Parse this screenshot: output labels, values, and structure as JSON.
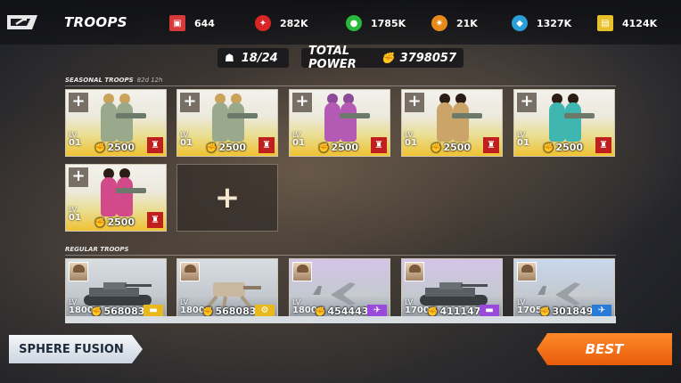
{
  "header": {
    "title": "TROOPS",
    "resources": [
      {
        "icon": "red-crate-icon",
        "value": "644",
        "color": "#d83a3a"
      },
      {
        "icon": "red-medal-icon",
        "value": "282K",
        "color": "#d82626"
      },
      {
        "icon": "green-orb-icon",
        "value": "1785K",
        "color": "#28b83c"
      },
      {
        "icon": "orange-gear-icon",
        "value": "21K",
        "color": "#e88a1a"
      },
      {
        "icon": "blue-crystal-icon",
        "value": "1327K",
        "color": "#2aa0d8"
      },
      {
        "icon": "gold-bar-icon",
        "value": "4124K",
        "color": "#e8c02a"
      }
    ]
  },
  "summary": {
    "deployed": "18/24",
    "total_power_label": "TOTAL POWER",
    "total_power": "3798057"
  },
  "seasonal": {
    "label": "SEASONAL TROOPS",
    "timer": "82d 12h",
    "cards": [
      {
        "level": "01",
        "power": "2500",
        "lv_label": "LV",
        "outfit": "#9aa88c",
        "skin": "#e5b995",
        "hair": "#c9a35a"
      },
      {
        "level": "01",
        "power": "2500",
        "lv_label": "LV",
        "outfit": "#9aa88c",
        "skin": "#e5b995",
        "hair": "#c9a35a"
      },
      {
        "level": "01",
        "power": "2500",
        "lv_label": "LV",
        "outfit": "#b55ab4",
        "skin": "#e5b995",
        "hair": "#8e4a9a"
      },
      {
        "level": "01",
        "power": "2500",
        "lv_label": "LV",
        "outfit": "#caa468",
        "skin": "#a87552",
        "hair": "#2b1d16"
      },
      {
        "level": "01",
        "power": "2500",
        "lv_label": "LV",
        "outfit": "#3fb6b0",
        "skin": "#a87552",
        "hair": "#2b1d16"
      },
      {
        "level": "01",
        "power": "2500",
        "lv_label": "LV",
        "outfit": "#d24a8a",
        "skin": "#a87552",
        "hair": "#2b1d16"
      }
    ]
  },
  "regular": {
    "label": "REGULAR TROOPS",
    "cards": [
      {
        "level": "1800",
        "power": "568083",
        "type": "tank",
        "type_icon": "tank-icon",
        "bg": "#d8dde2",
        "badge": "#e8b81c"
      },
      {
        "level": "1800",
        "power": "568083",
        "type": "mech",
        "type_icon": "walker-icon",
        "bg": "#d8dde2",
        "badge": "#e8b81c"
      },
      {
        "level": "1800",
        "power": "454443",
        "type": "aircraft",
        "type_icon": "jet-icon",
        "bg": "#d4c4e8",
        "badge": "#9a4ad8"
      },
      {
        "level": "1700",
        "power": "411147",
        "type": "tank",
        "type_icon": "tank-icon",
        "bg": "#d4c4e8",
        "badge": "#9a4ad8"
      },
      {
        "level": "1705",
        "power": "301849",
        "type": "aircraft",
        "type_icon": "jet-icon",
        "bg": "#c8d8ee",
        "badge": "#2a7ad8"
      }
    ]
  },
  "buttons": {
    "fusion": "SPHERE FUSION",
    "best": "BEST"
  }
}
